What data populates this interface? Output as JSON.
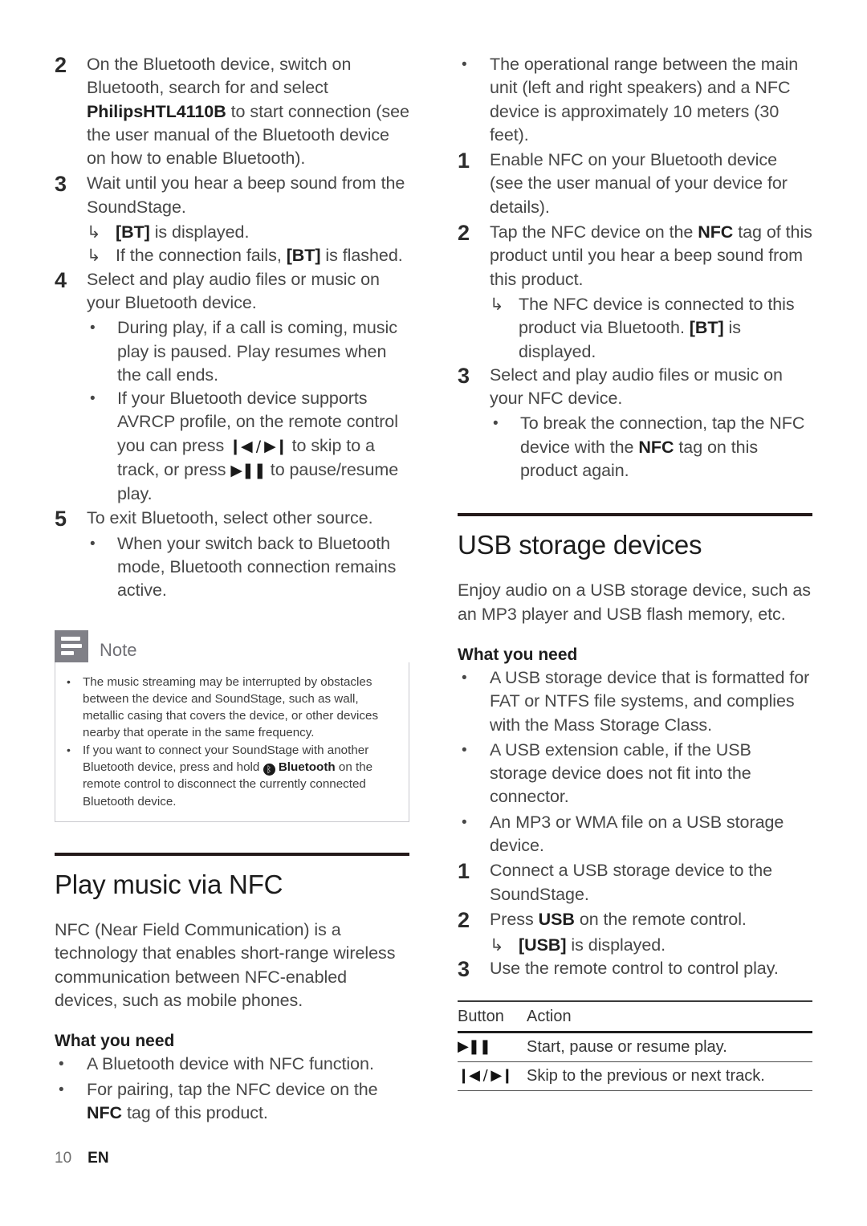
{
  "document": {
    "footer": {
      "page_number": "10",
      "language": "EN"
    },
    "colors": {
      "rule": "#241a1a",
      "note_icon_bg": "#808087",
      "body_text": "#474747"
    }
  },
  "icons": {
    "arrow": "↳",
    "bullet": "•",
    "play_pause": "▶❚❚",
    "prev": "❙◀",
    "next": "▶❙",
    "prev_next": "❙◀ / ▶❙",
    "bluetooth": "ᛒ"
  },
  "left_column": {
    "bluetooth_steps": [
      {
        "number": "2",
        "text_parts": [
          {
            "t": "On the Bluetooth device, switch on Bluetooth, search for and select ",
            "b": false
          },
          {
            "t": "PhilipsHTL4110B",
            "b": true
          },
          {
            "t": " to start connection (see the user manual of the Bluetooth device on how to enable Bluetooth).",
            "b": false
          }
        ]
      },
      {
        "number": "3",
        "text_parts": [
          {
            "t": "Wait until you hear a beep sound from the SoundStage.",
            "b": false
          }
        ],
        "arrows": [
          {
            "parts": [
              {
                "t": "[BT]",
                "b": true
              },
              {
                "t": " is displayed.",
                "b": false
              }
            ]
          },
          {
            "parts": [
              {
                "t": "If the connection fails, ",
                "b": false
              },
              {
                "t": "[BT]",
                "b": true
              },
              {
                "t": " is flashed.",
                "b": false
              }
            ]
          }
        ]
      },
      {
        "number": "4",
        "text_parts": [
          {
            "t": "Select and play audio files or music on your Bluetooth device.",
            "b": false
          }
        ],
        "bullets": [
          {
            "parts": [
              {
                "t": "During play, if a call is coming, music play is paused. Play resumes when the call ends.",
                "b": false
              }
            ]
          },
          {
            "parts": [
              {
                "t": "If your Bluetooth device supports AVRCP profile, on the remote control you can press ",
                "b": false
              },
              {
                "t": "❙◀ / ▶❙",
                "g": true
              },
              {
                "t": " to skip to a track, or press ",
                "b": false
              },
              {
                "t": "▶❚❚",
                "g": true
              },
              {
                "t": " to pause/resume play.",
                "b": false
              }
            ]
          }
        ]
      },
      {
        "number": "5",
        "text_parts": [
          {
            "t": "To exit Bluetooth, select other source.",
            "b": false
          }
        ],
        "bullets": [
          {
            "parts": [
              {
                "t": "When your switch back to Bluetooth mode, Bluetooth connection remains active.",
                "b": false
              }
            ]
          }
        ]
      }
    ],
    "note": {
      "title": "Note",
      "items": [
        {
          "parts": [
            {
              "t": "The music streaming may be interrupted by obstacles between the device and SoundStage, such as wall, metallic casing that covers the device, or other devices nearby that operate in the same frequency.",
              "b": false
            }
          ]
        },
        {
          "parts": [
            {
              "t": "If you want to connect your SoundStage with another Bluetooth device, press and hold ",
              "b": false
            },
            {
              "t": "BTICON",
              "icon": true
            },
            {
              "t": " Bluetooth",
              "b": true
            },
            {
              "t": " on the remote control to disconnect the currently connected Bluetooth device.",
              "b": false
            }
          ]
        }
      ]
    },
    "nfc_section": {
      "title": "Play music via NFC",
      "intro": "NFC (Near Field Communication) is a technology that enables short-range wireless communication between NFC-enabled devices, such as mobile phones.",
      "what_you_need_label": "What you need",
      "what_you_need": [
        {
          "parts": [
            {
              "t": "A Bluetooth device with NFC function.",
              "b": false
            }
          ]
        },
        {
          "parts": [
            {
              "t": "For pairing, tap the NFC device on the ",
              "b": false
            },
            {
              "t": "NFC",
              "b": true
            },
            {
              "t": " tag of this product.",
              "b": false
            }
          ]
        }
      ]
    }
  },
  "right_column": {
    "nfc_continued": {
      "lead_bullet": {
        "parts": [
          {
            "t": "The operational range between the main unit (left and right speakers) and a NFC device is approximately 10 meters (30 feet).",
            "b": false
          }
        ]
      },
      "steps": [
        {
          "number": "1",
          "text_parts": [
            {
              "t": "Enable NFC on your Bluetooth device (see the user manual of your device for details).",
              "b": false
            }
          ]
        },
        {
          "number": "2",
          "text_parts": [
            {
              "t": "Tap the NFC device on the ",
              "b": false
            },
            {
              "t": "NFC",
              "b": true
            },
            {
              "t": " tag of this product until you hear a beep sound from this product.",
              "b": false
            }
          ],
          "arrows": [
            {
              "parts": [
                {
                  "t": "The NFC device is connected to this product via Bluetooth. ",
                  "b": false
                },
                {
                  "t": "[BT]",
                  "b": true
                },
                {
                  "t": " is displayed.",
                  "b": false
                }
              ]
            }
          ]
        },
        {
          "number": "3",
          "text_parts": [
            {
              "t": "Select and play audio files or music on your NFC device.",
              "b": false
            }
          ],
          "bullets": [
            {
              "parts": [
                {
                  "t": "To break the connection, tap the NFC device with the ",
                  "b": false
                },
                {
                  "t": "NFC",
                  "b": true
                },
                {
                  "t": " tag on this product again.",
                  "b": false
                }
              ]
            }
          ]
        }
      ]
    },
    "usb_section": {
      "title": "USB storage devices",
      "intro": "Enjoy audio on a USB storage device, such as an MP3 player and USB flash memory, etc.",
      "what_you_need_label": "What you need",
      "what_you_need": [
        {
          "parts": [
            {
              "t": "A USB storage device that is formatted for FAT or NTFS file systems, and complies with the Mass Storage Class.",
              "b": false
            }
          ]
        },
        {
          "parts": [
            {
              "t": "A USB extension cable, if the USB storage device does not fit into the connector.",
              "b": false
            }
          ]
        },
        {
          "parts": [
            {
              "t": "An MP3 or WMA file on a USB storage device.",
              "b": false
            }
          ]
        }
      ],
      "steps": [
        {
          "number": "1",
          "text_parts": [
            {
              "t": "Connect a USB storage device to the SoundStage.",
              "b": false
            }
          ]
        },
        {
          "number": "2",
          "text_parts": [
            {
              "t": "Press ",
              "b": false
            },
            {
              "t": "USB",
              "b": true
            },
            {
              "t": " on the remote control.",
              "b": false
            }
          ],
          "arrows": [
            {
              "parts": [
                {
                  "t": "[USB]",
                  "b": true
                },
                {
                  "t": " is displayed.",
                  "b": false
                }
              ]
            }
          ]
        },
        {
          "number": "3",
          "text_parts": [
            {
              "t": "Use the remote control to control play.",
              "b": false
            }
          ]
        }
      ],
      "table": {
        "headers": [
          "Button",
          "Action"
        ],
        "rows": [
          {
            "button": "▶❚❚",
            "action": "Start, pause or resume play."
          },
          {
            "button": "❙◀ / ▶❙",
            "action": "Skip to the previous or next track."
          }
        ]
      }
    }
  }
}
